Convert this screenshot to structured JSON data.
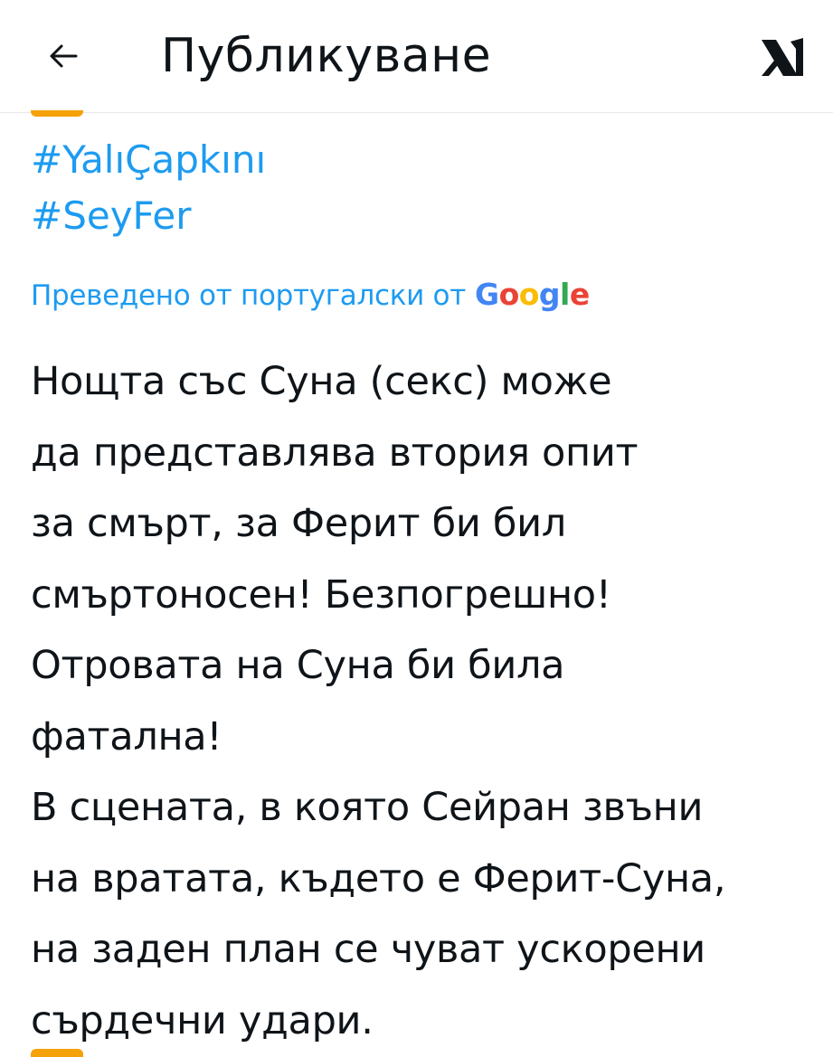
{
  "header": {
    "title": "Публикуване",
    "back_icon": "arrow-left-icon",
    "logo_icon": "x-logo-icon"
  },
  "post": {
    "hashtags": [
      "#YalıÇapkını",
      "#SeyFer"
    ],
    "translation": {
      "label": "Преведено от португалски от",
      "provider": "Google"
    },
    "lines": [
      "Нощта със Суна (секс) може",
      "да представлява втория опит",
      "за смърт, за Ферит би бил",
      "смъртоносен! Безпогрешно!",
      "Отровата на Суна би била",
      "фатална!",
      "В сцената, в която Сейран звъни",
      "на вратата, където е Ферит-Суна,",
      "на заден план се чуват ускорени",
      "сърдечни удари."
    ]
  },
  "colors": {
    "link": "#1d9bf0",
    "text": "#0f1419",
    "accent": "#f5a10a",
    "divider": "#e6e9ec",
    "google_blue": "#4285f4",
    "google_red": "#ea4335",
    "google_yellow": "#fbbc05",
    "google_green": "#34a853"
  }
}
